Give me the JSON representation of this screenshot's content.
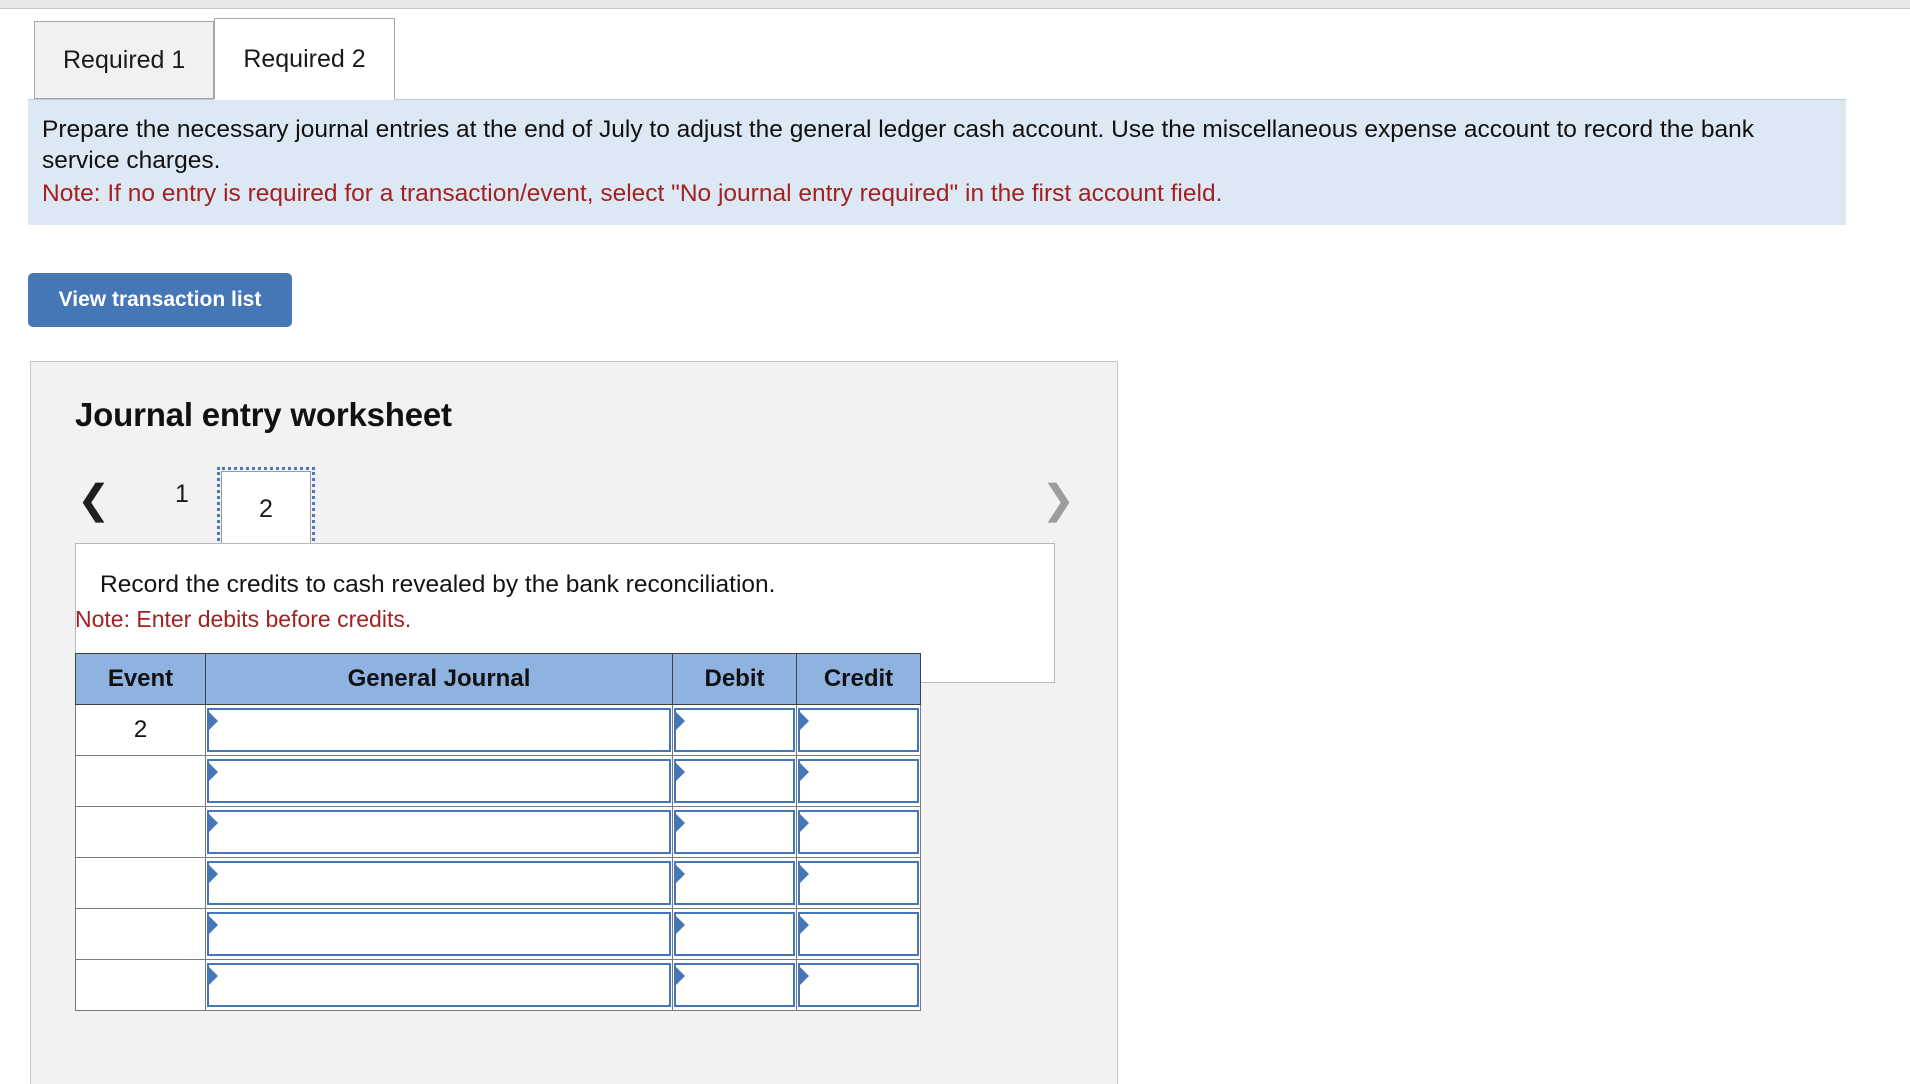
{
  "tabs": [
    {
      "label": "Required 1",
      "active": false
    },
    {
      "label": "Required 2",
      "active": true
    }
  ],
  "banner": {
    "instruction": "Prepare the necessary journal entries at the end of July to adjust the general ledger cash account. Use the miscellaneous expense account to record the bank service charges.",
    "note": "Note: If no entry is required for a transaction/event, select \"No journal entry required\" in the first account field."
  },
  "buttons": {
    "view_transaction_list": "View transaction list"
  },
  "worksheet": {
    "title": "Journal entry worksheet",
    "pager": {
      "prev_icon": "chevron-left-icon",
      "next_icon": "chevron-right-icon",
      "pages": [
        "1",
        "2"
      ],
      "selected": "2"
    },
    "prompt": "Record the credits to cash revealed by the bank reconciliation.",
    "debit_note": "Note: Enter debits before credits.",
    "table": {
      "headers": [
        "Event",
        "General Journal",
        "Debit",
        "Credit"
      ],
      "rows": [
        {
          "event": "2",
          "general_journal": "",
          "debit": "",
          "credit": ""
        },
        {
          "event": "",
          "general_journal": "",
          "debit": "",
          "credit": ""
        },
        {
          "event": "",
          "general_journal": "",
          "debit": "",
          "credit": ""
        },
        {
          "event": "",
          "general_journal": "",
          "debit": "",
          "credit": ""
        },
        {
          "event": "",
          "general_journal": "",
          "debit": "",
          "credit": ""
        },
        {
          "event": "",
          "general_journal": "",
          "debit": "",
          "credit": ""
        }
      ]
    }
  },
  "colors": {
    "banner_bg": "#dde8f5",
    "note_red": "#a42121",
    "button_blue": "#4576b5",
    "table_header_blue": "#8fb3e0",
    "panel_bg": "#f2f2f2"
  }
}
